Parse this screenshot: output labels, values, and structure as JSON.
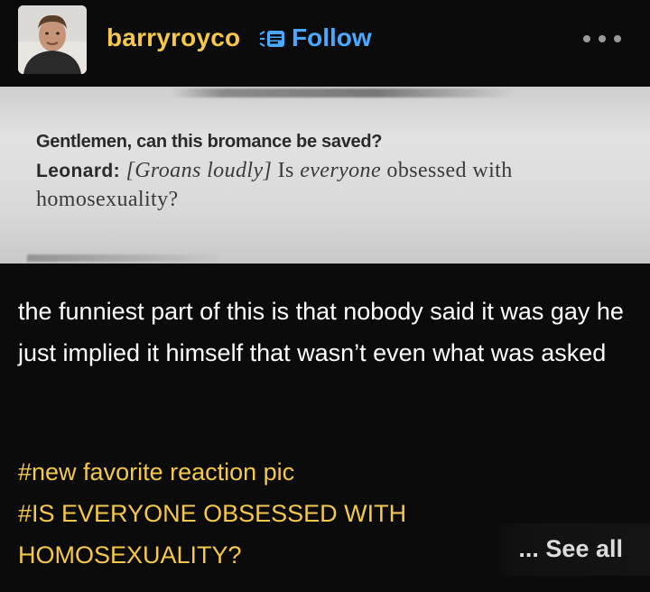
{
  "post": {
    "username": "barryroyco",
    "follow_label": "Follow",
    "more_icon": "more-dots-icon",
    "follow_icon": "follow-badge-icon"
  },
  "photo": {
    "heading": "Gentlemen, can this bromance be saved?",
    "speaker": "Leonard:",
    "stage_direction": "[Groans loudly]",
    "quote_prefix": "Is",
    "quote_italic": "everyone",
    "quote_suffix": "obsessed with",
    "quote_line2": "homosexuality?"
  },
  "caption": "the funniest part of this is that nobody said it was gay he just implied it himself that wasn’t even what was asked",
  "tags": [
    "#new favorite reaction pic",
    "#IS EVERYONE OBSESSED WITH HOMOSEXUALITY?"
  ],
  "see_all_label": "... See all",
  "colors": {
    "background": "#0b0b0b",
    "username": "#f4c84a",
    "follow": "#4aa8ff",
    "tags": "#f4c84a",
    "text": "#ffffff"
  }
}
